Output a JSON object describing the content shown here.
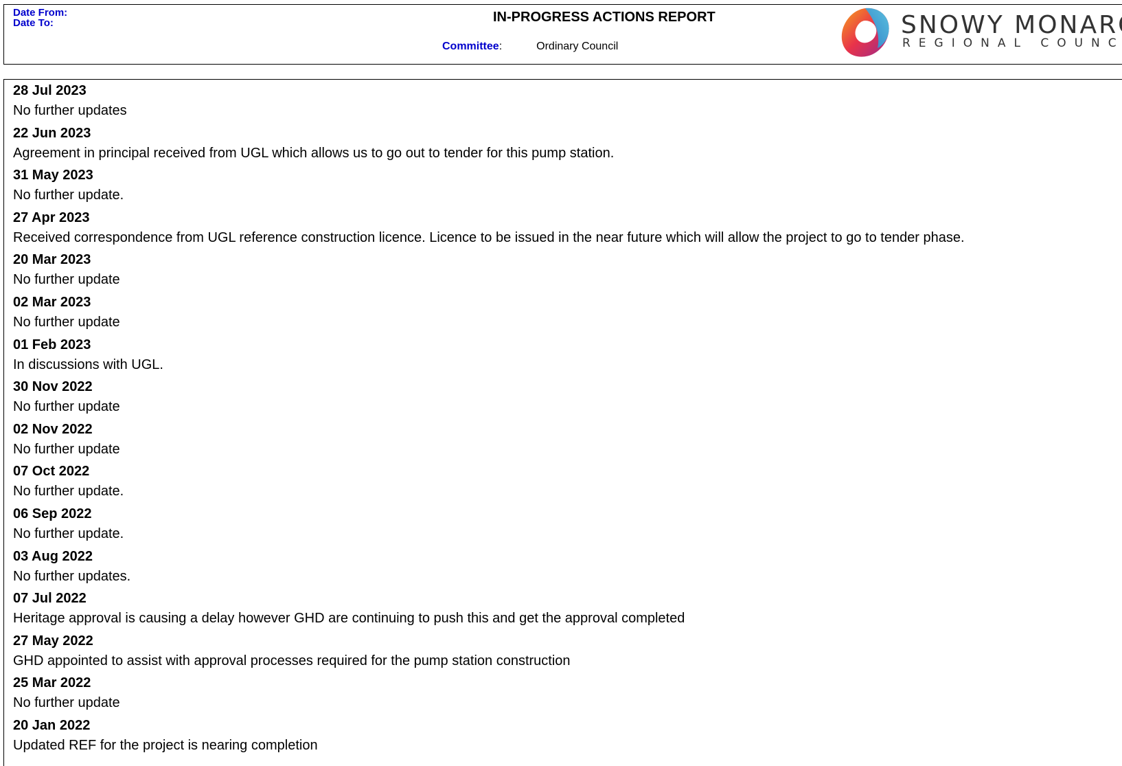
{
  "header": {
    "date_from_label": "Date From:",
    "date_to_label": "Date To:",
    "title": "IN-PROGRESS ACTIONS REPORT",
    "committee_label": "Committee",
    "committee_colon": ":",
    "committee_value": "Ordinary Council"
  },
  "logo": {
    "line1": "SNOWY MONARO",
    "line2": "REGIONAL COUNCIL",
    "colors": [
      "#f7a21b",
      "#e8334a",
      "#9b2a8b",
      "#2f9fd8",
      "#5bc0de"
    ]
  },
  "entries": [
    {
      "date": "28 Jul 2023",
      "text": "No further updates"
    },
    {
      "date": "22 Jun 2023",
      "text": "Agreement in principal received from UGL which allows us to go out to tender for this pump station."
    },
    {
      "date": "31 May 2023",
      "text": "No further update."
    },
    {
      "date": "27 Apr 2023",
      "text": "Received correspondence from UGL reference construction licence. Licence to be issued in the near future which will allow the project to go to tender phase."
    },
    {
      "date": "20 Mar 2023",
      "text": "No further update"
    },
    {
      "date": "02 Mar 2023",
      "text": "No further update"
    },
    {
      "date": "01 Feb 2023",
      "text": "In discussions with UGL."
    },
    {
      "date": "30 Nov 2022",
      "text": "No further update"
    },
    {
      "date": "02 Nov 2022",
      "text": "No further update"
    },
    {
      "date": "07 Oct 2022",
      "text": "No further update."
    },
    {
      "date": "06 Sep 2022",
      "text": "No further update."
    },
    {
      "date": "03 Aug 2022",
      "text": "No further updates."
    },
    {
      "date": "07 Jul 2022",
      "text": "Heritage approval is causing a delay however GHD are continuing to push this and get the approval completed"
    },
    {
      "date": "27 May 2022",
      "text": "GHD appointed to assist with approval processes required for the pump station construction"
    },
    {
      "date": "25 Mar 2022",
      "text": "No further update"
    },
    {
      "date": "20 Jan 2022",
      "text": "Updated REF for the project is nearing completion"
    }
  ]
}
